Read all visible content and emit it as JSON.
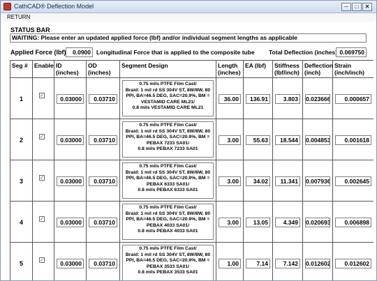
{
  "window": {
    "title": "CathCAD® Deflection Model",
    "minimize": "─",
    "maximize": "□",
    "close": "✕"
  },
  "menu": {
    "return_label": "RETURN"
  },
  "status": {
    "label": "STATUS BAR",
    "message": "WAITING: Please enter an updated applied force (lbf) and/or individual segment lengths as applicable"
  },
  "force": {
    "label": "Applied Force (lbf)",
    "value": "0.0900",
    "description": "Longitudinal Force that is applied to the composite tube"
  },
  "total": {
    "label": "Total Deflection (inches)",
    "value": "0.069750"
  },
  "columns": {
    "seg": "Seg #",
    "enable": "Enable",
    "id": "ID (inches)",
    "od": "OD (inches)",
    "design": "Segment Design",
    "length": "Length (inches)",
    "ea": "EA (lbf)",
    "stiffness": "Stiffness (lbf/inch)",
    "deflection": "Deflection (inch)",
    "strain": "Strain (inch/inch)"
  },
  "rows": [
    {
      "seg": "1",
      "enabled": true,
      "check": "✓",
      "id": "0.03000",
      "od": "0.03710",
      "design": "0.75 mils PTFE Film Cast/\nBraid: 1 mil rd SS 304V ST, 8W/8W, 80 PPI, BA=46.5 DEG, SAC=20.9%, BM = VESTAMID CARE ML21/\n0.8 mils VESTAMID CARE ML21",
      "length": "36.00",
      "ea": "136.91",
      "stiffness": "3.803",
      "deflection": "0.023666",
      "strain": "0.000657"
    },
    {
      "seg": "2",
      "enabled": true,
      "check": "✓",
      "id": "0.03000",
      "od": "0.03710",
      "design": "0.75 mils PTFE Film Cast/\nBraid: 1 mil rd SS 304V ST, 8W/8W, 80 PPI, BA=46.5 DEG, SAC=20.9%, BM = PEBAX 7233 SA01/\n0.8 mils PEBAX 7233 SA01",
      "length": "3.00",
      "ea": "55.63",
      "stiffness": "18.544",
      "deflection": "0.004853",
      "strain": "0.001618"
    },
    {
      "seg": "3",
      "enabled": true,
      "check": "✓",
      "id": "0.03000",
      "od": "0.03710",
      "design": "0.75 mils PTFE Film Cast/\nBraid: 1 mil rd SS 304V ST, 8W/8W, 80 PPI, BA=46.5 DEG, SAC=20.9%, BM = PEBAX 6333 SA01/\n0.8 mils PEBAX 6333 SA01",
      "length": "3.00",
      "ea": "34.02",
      "stiffness": "11.341",
      "deflection": "0.007936",
      "strain": "0.002645"
    },
    {
      "seg": "4",
      "enabled": true,
      "check": "✓",
      "id": "0.03000",
      "od": "0.03710",
      "design": "0.75 mils PTFE Film Cast/\nBraid: 1 mil rd SS 304V ST, 8W/8W, 80 PPI, BA=46.5 DEG, SAC=20.9%, BM = PEBAX 4033 SA01/\n0.8 mils PEBAX 4033 SA01",
      "length": "3.00",
      "ea": "13.05",
      "stiffness": "4.349",
      "deflection": "0.020693",
      "strain": "0.006898"
    },
    {
      "seg": "5",
      "enabled": true,
      "check": "✓",
      "id": "0.03000",
      "od": "0.03710",
      "design": "0.75 mils PTFE Film Cast/\nBraid: 1 mil rd SS 304V ST, 8W/8W, 80 PPI, BA=46.5 DEG, SAC=20.9%, BM = PEBAX 3533 SA01/\n0.8 mils PEBAX 3533 SA01",
      "length": "1.00",
      "ea": "7.14",
      "stiffness": "7.142",
      "deflection": "0.012602",
      "strain": "0.012602"
    }
  ]
}
